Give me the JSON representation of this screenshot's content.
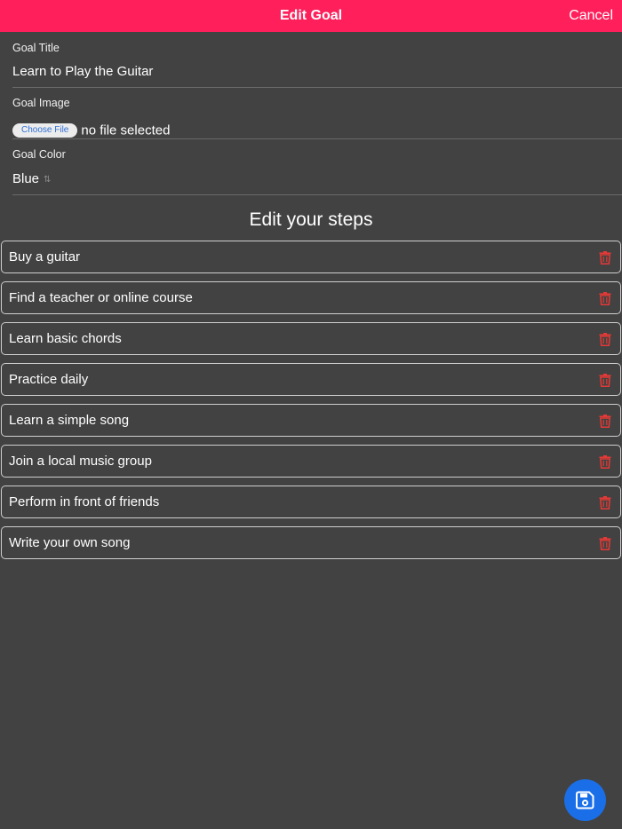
{
  "header": {
    "title": "Edit Goal",
    "cancel_label": "Cancel"
  },
  "form": {
    "goal_title": {
      "label": "Goal Title",
      "value": "Learn to Play the Guitar"
    },
    "goal_image": {
      "label": "Goal Image",
      "button_label": "Choose File",
      "status": "no file selected"
    },
    "goal_color": {
      "label": "Goal Color",
      "value": "Blue"
    }
  },
  "steps_section": {
    "title": "Edit your steps",
    "steps": [
      "Buy a guitar",
      "Find a teacher or online course",
      "Learn basic chords",
      "Practice daily",
      "Learn a simple song",
      "Join a local music group",
      "Perform in front of friends",
      "Write your own song"
    ]
  },
  "icons": {
    "delete": "trash-icon",
    "save": "floppy-disk-icon",
    "select": "select-arrows-icon"
  },
  "colors": {
    "header": "#ff1f5b",
    "background": "#424242",
    "delete": "#e53935",
    "save_button": "#1a6fe8"
  }
}
